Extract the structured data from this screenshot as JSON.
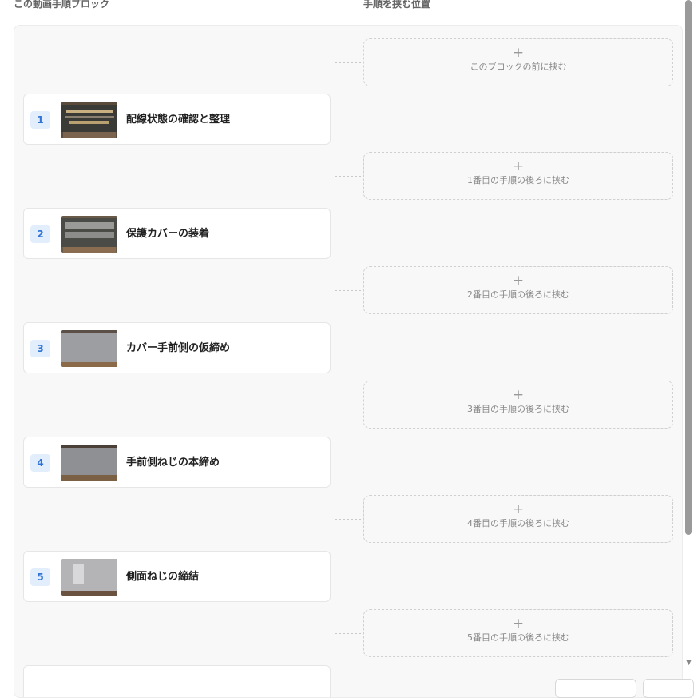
{
  "headers": {
    "left": "この動画手順ブロック",
    "right": "手順を挟む位置"
  },
  "steps": [
    {
      "number": "1",
      "title": "配線状態の確認と整理"
    },
    {
      "number": "2",
      "title": "保護カバーの装着"
    },
    {
      "number": "3",
      "title": "カバー手前側の仮締め"
    },
    {
      "number": "4",
      "title": "手前側ねじの本締め"
    },
    {
      "number": "5",
      "title": "側面ねじの締結"
    }
  ],
  "slots": [
    {
      "plus": "+",
      "label": "このブロックの前に挟む"
    },
    {
      "plus": "+",
      "label": "1番目の手順の後ろに挟む"
    },
    {
      "plus": "+",
      "label": "2番目の手順の後ろに挟む"
    },
    {
      "plus": "+",
      "label": "3番目の手順の後ろに挟む"
    },
    {
      "plus": "+",
      "label": "4番目の手順の後ろに挟む"
    },
    {
      "plus": "+",
      "label": "5番目の手順の後ろに挟む"
    }
  ],
  "colors": {
    "badge_bg": "#e3eefc",
    "badge_text": "#2f74d6",
    "panel_bg": "#f8f8f8"
  },
  "icons": {
    "slot": "plus-icon",
    "scroll": "caret-down-icon"
  }
}
